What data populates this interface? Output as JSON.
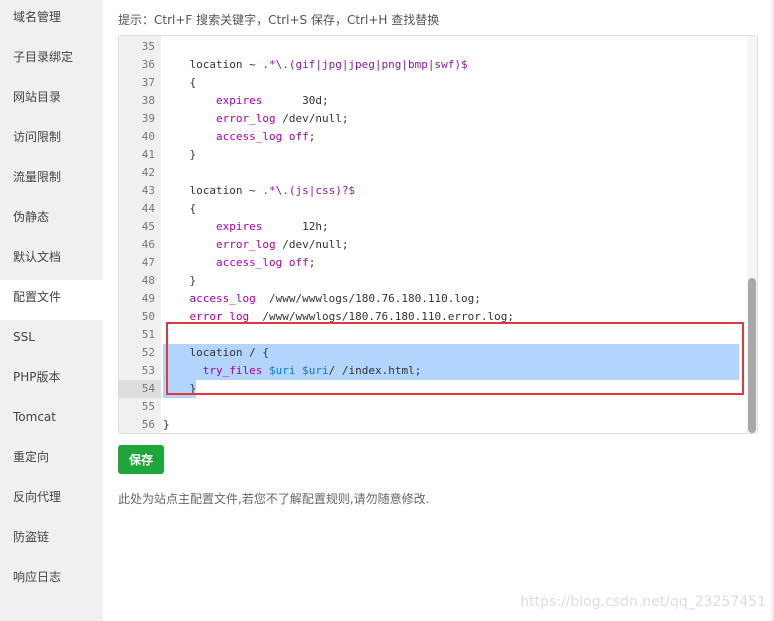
{
  "sidebar": {
    "items": [
      "域名管理",
      "子目录绑定",
      "网站目录",
      "访问限制",
      "流量限制",
      "伪静态",
      "默认文档",
      "配置文件",
      "SSL",
      "PHP版本",
      "Tomcat",
      "重定向",
      "反向代理",
      "防盗链",
      "响应日志"
    ],
    "active": "配置文件"
  },
  "hint": "提示：Ctrl+F 搜索关键字，Ctrl+S 保存，Ctrl+H 查找替换",
  "editor": {
    "current_line": 54,
    "lines": [
      {
        "n": "35",
        "t": []
      },
      {
        "n": "36",
        "t": [
          [
            "    location ~ ",
            ""
          ],
          [
            ".*\\.(gif|jpg|jpeg|png|bmp|swf)$",
            "re"
          ]
        ]
      },
      {
        "n": "37",
        "t": [
          [
            "    {",
            ""
          ]
        ]
      },
      {
        "n": "38",
        "t": [
          [
            "        ",
            ""
          ],
          [
            "expires",
            "kw"
          ],
          [
            "      30d;",
            ""
          ]
        ]
      },
      {
        "n": "39",
        "t": [
          [
            "        ",
            ""
          ],
          [
            "error_log",
            "kw"
          ],
          [
            " /dev/null;",
            ""
          ]
        ]
      },
      {
        "n": "40",
        "t": [
          [
            "        ",
            ""
          ],
          [
            "access_log",
            "kw"
          ],
          [
            " ",
            ""
          ],
          [
            "off",
            "kw"
          ],
          [
            ";",
            ""
          ]
        ]
      },
      {
        "n": "41",
        "t": [
          [
            "    }",
            ""
          ]
        ]
      },
      {
        "n": "42",
        "t": []
      },
      {
        "n": "43",
        "t": [
          [
            "    location ~ ",
            ""
          ],
          [
            ".*\\.(js|css)?$",
            "re"
          ]
        ]
      },
      {
        "n": "44",
        "t": [
          [
            "    {",
            ""
          ]
        ]
      },
      {
        "n": "45",
        "t": [
          [
            "        ",
            ""
          ],
          [
            "expires",
            "kw"
          ],
          [
            "      12h;",
            ""
          ]
        ]
      },
      {
        "n": "46",
        "t": [
          [
            "        ",
            ""
          ],
          [
            "error_log",
            "kw"
          ],
          [
            " /dev/null;",
            ""
          ]
        ]
      },
      {
        "n": "47",
        "t": [
          [
            "        ",
            ""
          ],
          [
            "access_log",
            "kw"
          ],
          [
            " ",
            ""
          ],
          [
            "off",
            "kw"
          ],
          [
            ";",
            ""
          ]
        ]
      },
      {
        "n": "48",
        "t": [
          [
            "    }",
            ""
          ]
        ]
      },
      {
        "n": "49",
        "t": [
          [
            "    ",
            ""
          ],
          [
            "access_log",
            "kw"
          ],
          [
            "  /www/wwwlogs/180.76.180.110.log;",
            ""
          ]
        ]
      },
      {
        "n": "50",
        "t": [
          [
            "    ",
            ""
          ],
          [
            "error_log",
            "kw"
          ],
          [
            "  /www/wwwlogs/180.76.180.110.error.log;",
            ""
          ]
        ]
      },
      {
        "n": "51",
        "t": []
      },
      {
        "n": "52",
        "t": [
          [
            "    location / {",
            ""
          ]
        ]
      },
      {
        "n": "53",
        "t": [
          [
            "      ",
            ""
          ],
          [
            "try_files",
            "kw"
          ],
          [
            " ",
            ""
          ],
          [
            "$uri",
            "var"
          ],
          [
            " ",
            ""
          ],
          [
            "$uri",
            "var"
          ],
          [
            "/ /index.html;",
            ""
          ]
        ]
      },
      {
        "n": "54",
        "t": [
          [
            "    }",
            ""
          ]
        ]
      },
      {
        "n": "55",
        "t": []
      },
      {
        "n": "56",
        "t": [
          [
            "}",
            ""
          ]
        ]
      }
    ],
    "selected_lines": [
      "52",
      "53",
      "54"
    ]
  },
  "save_label": "保存",
  "note": "此处为站点主配置文件,若您不了解配置规则,请勿随意修改.",
  "watermark": "https://blog.csdn.net/qq_23257451"
}
